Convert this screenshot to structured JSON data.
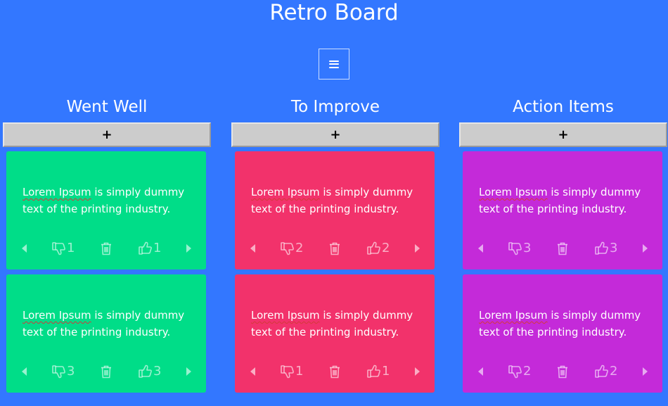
{
  "app": {
    "title": "Retro Board",
    "menu_icon": "hamburger-menu-icon",
    "add_label": "+"
  },
  "colors": {
    "background": "#3377ff",
    "went_well": "#00dd88",
    "to_improve": "#f2326b",
    "action_items": "#c42ad9"
  },
  "columns": [
    {
      "title": "Went Well",
      "color": "#00dd88",
      "cards": [
        {
          "text_word": "Lorem Ipsum",
          "text_rest": " is simply dummy text of the printing industry.",
          "dislikes": "1",
          "likes": "1"
        },
        {
          "text_word": "Lorem Ipsum",
          "text_rest": " is simply dummy text of the printing industry.",
          "dislikes": "3",
          "likes": "3"
        }
      ]
    },
    {
      "title": "To Improve",
      "color": "#f2326b",
      "cards": [
        {
          "text_word": "Lorem Ipsum",
          "text_rest": " is simply dummy text of the printing industry.",
          "dislikes": "2",
          "likes": "2"
        },
        {
          "text_word": "Lorem Ipsum",
          "text_rest": " is simply dummy text of the printing industry.",
          "dislikes": "1",
          "likes": "1"
        }
      ]
    },
    {
      "title": "Action Items",
      "color": "#c42ad9",
      "cards": [
        {
          "text_word": "Lorem Ipsum",
          "text_rest": " is simply dummy text of the printing industry.",
          "dislikes": "3",
          "likes": "3"
        },
        {
          "text_word": "Lorem Ipsum",
          "text_rest": " is simply dummy text of the printing industry.",
          "dislikes": "2",
          "likes": "2"
        }
      ]
    }
  ]
}
